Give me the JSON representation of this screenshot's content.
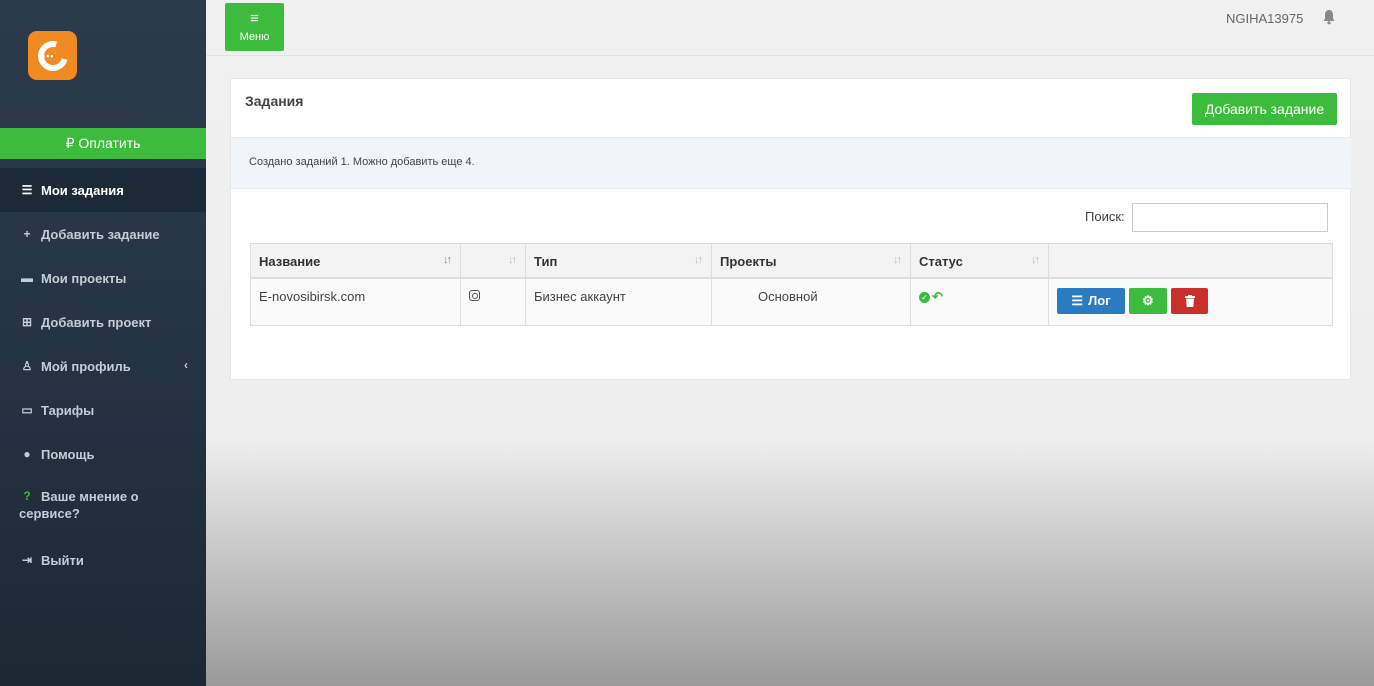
{
  "sidebar": {
    "logo": "circle-c-logo",
    "pay_label": "₽ Оплатить",
    "items": [
      {
        "label": "Мои задания",
        "icon": "tasks-list-icon",
        "active": true
      },
      {
        "label": "Добавить задание",
        "icon": "plus-icon"
      },
      {
        "label": "Мои проекты",
        "icon": "briefcase-icon"
      },
      {
        "label": "Добавить проект",
        "icon": "plus-square-icon"
      },
      {
        "label": "Мой профиль",
        "icon": "user-icon"
      },
      {
        "label": "Тарифы",
        "icon": "credit-card-icon"
      },
      {
        "label": "Помощь",
        "icon": "question-circle-icon"
      },
      {
        "label": "Ваше мнение о сервисе?",
        "icon": "question-icon"
      },
      {
        "label": "Выйти",
        "icon": "sign-out-icon"
      }
    ]
  },
  "topbar": {
    "menu_label": "Меню",
    "username": "NGIHA13975"
  },
  "panel": {
    "title": "Задания",
    "add_button": "Добавить задание",
    "info": "Создано заданий 1. Можно добавить еще 4.",
    "search_label": "Поиск:",
    "search_value": ""
  },
  "table": {
    "columns": [
      "Название",
      "",
      "Тип",
      "Проекты",
      "Статус",
      ""
    ],
    "rows": [
      {
        "name": "E-novosibirsk.com",
        "network_icon": "instagram-icon",
        "type": "Бизнес аккаунт",
        "project": "Основной",
        "status": "active",
        "log_label": "Лог"
      }
    ]
  },
  "colors": {
    "accent_green": "#3dbb3d",
    "log_blue": "#2a7bc2",
    "delete_red": "#c9302c",
    "sidebar_bg": "#263545"
  }
}
